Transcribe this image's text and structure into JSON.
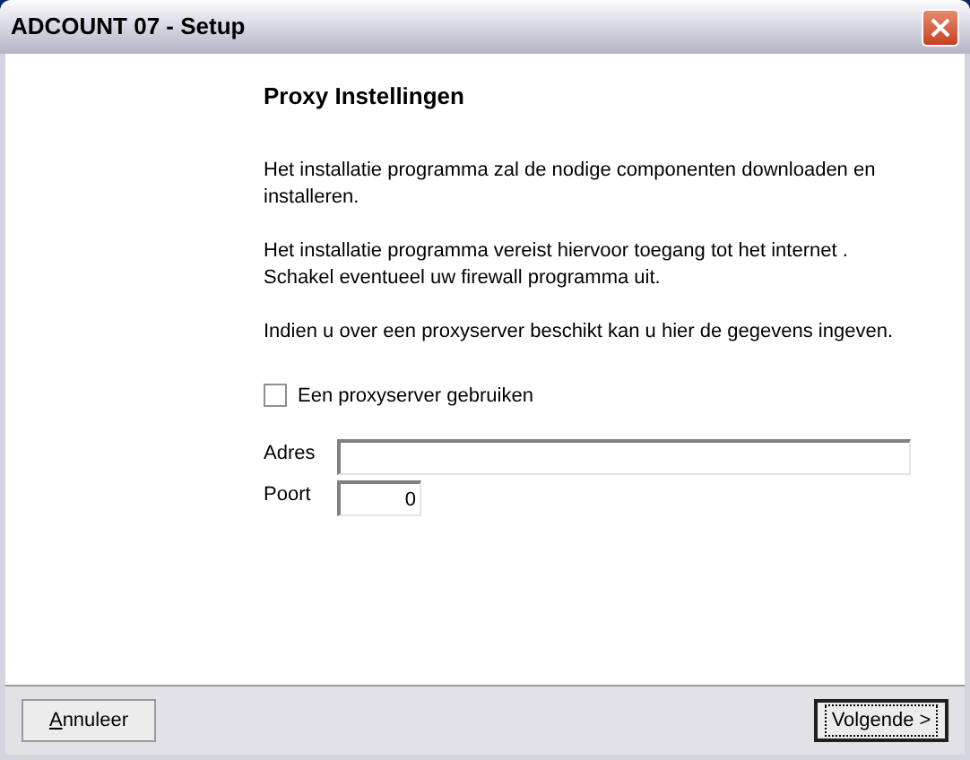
{
  "window": {
    "title": "ADCOUNT 07 - Setup"
  },
  "heading": "Proxy Instellingen",
  "paragraphs": [
    "Het installatie programma zal de nodige componenten downloaden en installeren.",
    "Het installatie programma vereist hiervoor toegang tot het internet . Schakel eventueel uw firewall programma uit.",
    "Indien u over een proxyserver beschikt kan u hier de gegevens ingeven."
  ],
  "proxy_checkbox": {
    "label": "Een proxyserver gebruiken",
    "checked": false
  },
  "fields": [
    {
      "label": "Adres",
      "kind": "wide"
    },
    {
      "label": "Poort",
      "value": "0",
      "kind": "number"
    }
  ],
  "buttons": [
    {
      "label": "Annuleer",
      "first_letter_underlined": true,
      "default": false
    },
    {
      "label": "Volgende >",
      "default": true
    }
  ]
}
